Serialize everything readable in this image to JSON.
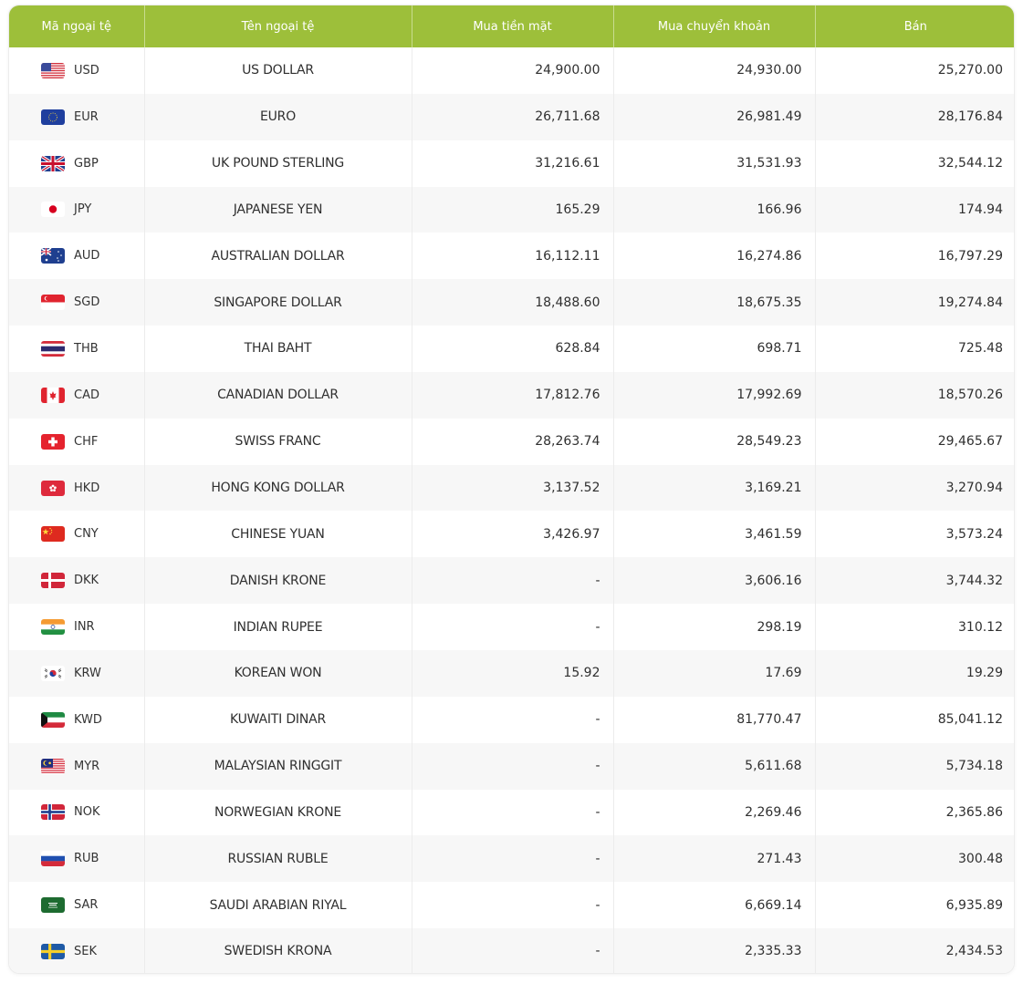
{
  "table": {
    "header_color": "#9dbf3a",
    "columns": [
      "Mã ngoại tệ",
      "Tên ngoại tệ",
      "Mua tiền mặt",
      "Mua chuyển khoản",
      "Bán"
    ],
    "rows": [
      {
        "code": "USD",
        "flag": "us-flag-icon",
        "name": "US DOLLAR",
        "cash_buy": "24,900.00",
        "transfer_buy": "24,930.00",
        "sell": "25,270.00"
      },
      {
        "code": "EUR",
        "flag": "eu-flag-icon",
        "name": "EURO",
        "cash_buy": "26,711.68",
        "transfer_buy": "26,981.49",
        "sell": "28,176.84"
      },
      {
        "code": "GBP",
        "flag": "gb-flag-icon",
        "name": "UK POUND STERLING",
        "cash_buy": "31,216.61",
        "transfer_buy": "31,531.93",
        "sell": "32,544.12"
      },
      {
        "code": "JPY",
        "flag": "jp-flag-icon",
        "name": "JAPANESE YEN",
        "cash_buy": "165.29",
        "transfer_buy": "166.96",
        "sell": "174.94"
      },
      {
        "code": "AUD",
        "flag": "au-flag-icon",
        "name": "AUSTRALIAN DOLLAR",
        "cash_buy": "16,112.11",
        "transfer_buy": "16,274.86",
        "sell": "16,797.29"
      },
      {
        "code": "SGD",
        "flag": "sg-flag-icon",
        "name": "SINGAPORE DOLLAR",
        "cash_buy": "18,488.60",
        "transfer_buy": "18,675.35",
        "sell": "19,274.84"
      },
      {
        "code": "THB",
        "flag": "th-flag-icon",
        "name": "THAI BAHT",
        "cash_buy": "628.84",
        "transfer_buy": "698.71",
        "sell": "725.48"
      },
      {
        "code": "CAD",
        "flag": "ca-flag-icon",
        "name": "CANADIAN DOLLAR",
        "cash_buy": "17,812.76",
        "transfer_buy": "17,992.69",
        "sell": "18,570.26"
      },
      {
        "code": "CHF",
        "flag": "ch-flag-icon",
        "name": "SWISS FRANC",
        "cash_buy": "28,263.74",
        "transfer_buy": "28,549.23",
        "sell": "29,465.67"
      },
      {
        "code": "HKD",
        "flag": "hk-flag-icon",
        "name": "HONG KONG DOLLAR",
        "cash_buy": "3,137.52",
        "transfer_buy": "3,169.21",
        "sell": "3,270.94"
      },
      {
        "code": "CNY",
        "flag": "cn-flag-icon",
        "name": "CHINESE YUAN",
        "cash_buy": "3,426.97",
        "transfer_buy": "3,461.59",
        "sell": "3,573.24"
      },
      {
        "code": "DKK",
        "flag": "dk-flag-icon",
        "name": "DANISH KRONE",
        "cash_buy": "-",
        "transfer_buy": "3,606.16",
        "sell": "3,744.32"
      },
      {
        "code": "INR",
        "flag": "in-flag-icon",
        "name": "INDIAN RUPEE",
        "cash_buy": "-",
        "transfer_buy": "298.19",
        "sell": "310.12"
      },
      {
        "code": "KRW",
        "flag": "kr-flag-icon",
        "name": "KOREAN WON",
        "cash_buy": "15.92",
        "transfer_buy": "17.69",
        "sell": "19.29"
      },
      {
        "code": "KWD",
        "flag": "kw-flag-icon",
        "name": "KUWAITI DINAR",
        "cash_buy": "-",
        "transfer_buy": "81,770.47",
        "sell": "85,041.12"
      },
      {
        "code": "MYR",
        "flag": "my-flag-icon",
        "name": "MALAYSIAN RINGGIT",
        "cash_buy": "-",
        "transfer_buy": "5,611.68",
        "sell": "5,734.18"
      },
      {
        "code": "NOK",
        "flag": "no-flag-icon",
        "name": "NORWEGIAN KRONE",
        "cash_buy": "-",
        "transfer_buy": "2,269.46",
        "sell": "2,365.86"
      },
      {
        "code": "RUB",
        "flag": "ru-flag-icon",
        "name": "RUSSIAN RUBLE",
        "cash_buy": "-",
        "transfer_buy": "271.43",
        "sell": "300.48"
      },
      {
        "code": "SAR",
        "flag": "sa-flag-icon",
        "name": "SAUDI ARABIAN RIYAL",
        "cash_buy": "-",
        "transfer_buy": "6,669.14",
        "sell": "6,935.89"
      },
      {
        "code": "SEK",
        "flag": "se-flag-icon",
        "name": "SWEDISH KRONA",
        "cash_buy": "-",
        "transfer_buy": "2,335.33",
        "sell": "2,434.53"
      }
    ]
  }
}
